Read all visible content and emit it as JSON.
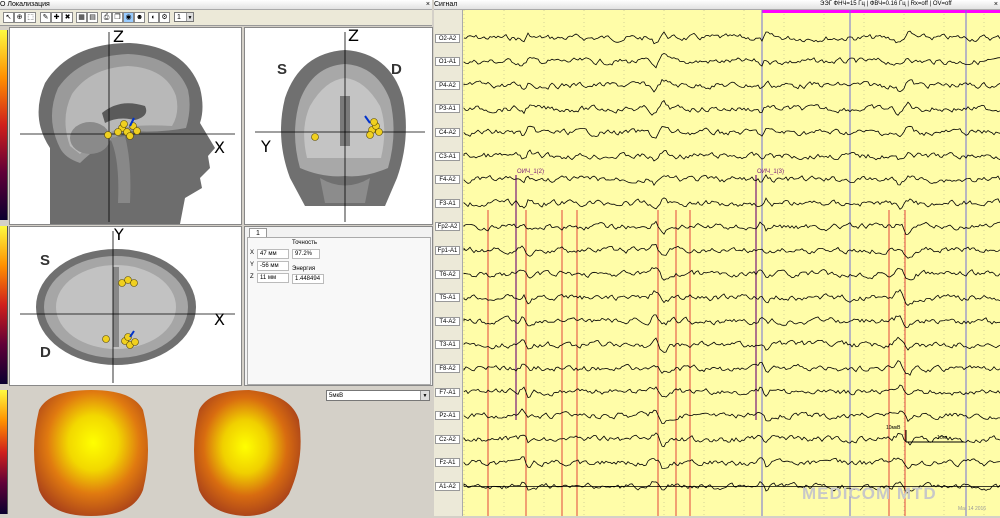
{
  "left_window": {
    "title": "О Локализация",
    "close": "×"
  },
  "right_window": {
    "title": "Сигнал",
    "close": "×"
  },
  "toolbar": {
    "select_value": "1"
  },
  "views": {
    "sagittal": {
      "axis_vertical": "Z",
      "axis_horizontal": "X"
    },
    "coronal": {
      "axis_vertical": "Z",
      "axis_horizontal": "Y",
      "left_side": "S",
      "right_side": "D"
    },
    "axial": {
      "axis_vertical": "Y",
      "axis_horizontal": "X",
      "top_side": "S",
      "bottom_side": "D"
    }
  },
  "info": {
    "tab": "1",
    "x_label": "X",
    "x_value": "47 мм",
    "y_label": "Y",
    "y_value": "-56 мм",
    "z_label": "Z",
    "z_value": "11 мм",
    "accuracy_label": "Точность",
    "accuracy_value": "97.2%",
    "energy_label": "Энергия",
    "energy_value": "1.448494"
  },
  "map_select": {
    "value": "5мкВ"
  },
  "eeg": {
    "status": "ЭЭГ ФНЧ=15 Гц | ФВЧ=0.16 Гц | Rx=off | OV=off",
    "channels": [
      "O2-A2",
      "O1-A1",
      "P4-A2",
      "P3-A1",
      "C4-A2",
      "C3-A1",
      "F4-A2",
      "F3-A1",
      "Fp2-A2",
      "Fp1-A1",
      "T6-A2",
      "T5-A1",
      "T4-A2",
      "T3-A1",
      "F8-A2",
      "F7-A1",
      "Pz-A1",
      "Cz-A2",
      "Fz-A1",
      "A1-A2"
    ],
    "markers": [
      "ОИЧ_1(2)",
      "ОИЧ_1(3)"
    ],
    "scale_amplitude": "10мкВ",
    "scale_time": "1сек",
    "colors": {
      "background": "#fffda8",
      "trace": "#000000",
      "marker_red": "#e03030",
      "marker_purple": "#7a1a7a",
      "cursor_blue": "#7070d8",
      "selection_magenta": "#ff00ff"
    }
  },
  "watermark": {
    "text": "MEDICOM MTD",
    "date": "Mar 14 2016"
  }
}
